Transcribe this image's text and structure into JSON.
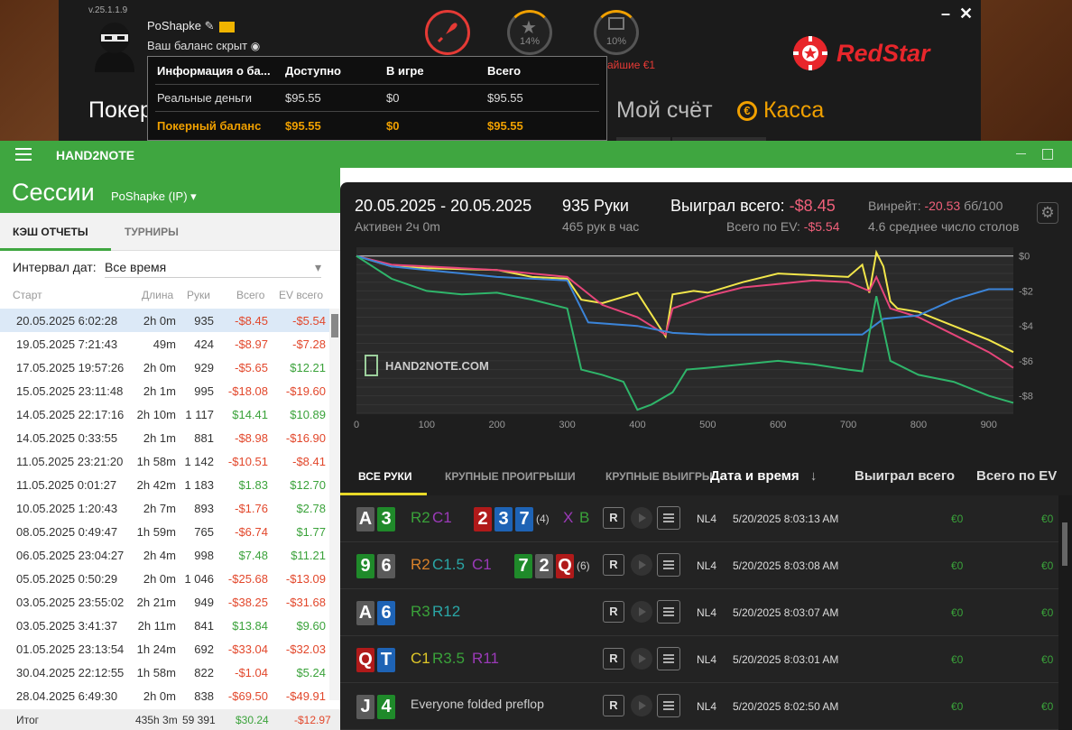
{
  "poker_client": {
    "version": "v.25.1.1.9",
    "username": "PoShapke",
    "balance_hidden": "Ваш баланс скрыт",
    "rakeback_pct": "14%",
    "gift_pct": "10%",
    "partial_text": "айшие €1",
    "brand": "RedStar",
    "tabs": [
      "Покер",
      "Мой счёт",
      "Касса"
    ]
  },
  "balance_popup": {
    "headers": [
      "Информация о ба...",
      "Доступно",
      "В игре",
      "Всего"
    ],
    "rows": [
      {
        "label": "Реальные деньги",
        "available": "$95.55",
        "in_game": "$0",
        "total": "$95.55"
      },
      {
        "label": "Покерный баланс",
        "available": "$95.55",
        "in_game": "$0",
        "total": "$95.55"
      }
    ]
  },
  "app": {
    "title": "HAND2NOTE",
    "page_title": "Сессии",
    "player": "PoShapke (IP)",
    "tabs": [
      "КЭШ ОТЧЕТЫ",
      "ТУРНИРЫ"
    ],
    "interval_label": "Интервал дат:",
    "interval_value": "Все время",
    "columns": [
      "Старт",
      "Длина",
      "Руки",
      "Всего",
      "EV всего"
    ],
    "sessions": [
      {
        "start": "20.05.2025 6:02:28",
        "len": "2h 0m",
        "hands": "935",
        "total": "-$8.45",
        "ev": "-$5.54"
      },
      {
        "start": "19.05.2025 7:21:43",
        "len": "49m",
        "hands": "424",
        "total": "-$8.97",
        "ev": "-$7.28"
      },
      {
        "start": "17.05.2025 19:57:26",
        "len": "2h 0m",
        "hands": "929",
        "total": "-$5.65",
        "ev": "$12.21"
      },
      {
        "start": "15.05.2025 23:11:48",
        "len": "2h 1m",
        "hands": "995",
        "total": "-$18.08",
        "ev": "-$19.60"
      },
      {
        "start": "14.05.2025 22:17:16",
        "len": "2h 10m",
        "hands": "1 117",
        "total": "$14.41",
        "ev": "$10.89"
      },
      {
        "start": "14.05.2025 0:33:55",
        "len": "2h 1m",
        "hands": "881",
        "total": "-$8.98",
        "ev": "-$16.90"
      },
      {
        "start": "11.05.2025 23:21:20",
        "len": "1h 58m",
        "hands": "1 142",
        "total": "-$10.51",
        "ev": "-$8.41"
      },
      {
        "start": "11.05.2025 0:01:27",
        "len": "2h 42m",
        "hands": "1 183",
        "total": "$1.83",
        "ev": "$12.70"
      },
      {
        "start": "10.05.2025 1:20:43",
        "len": "2h 7m",
        "hands": "893",
        "total": "-$1.76",
        "ev": "$2.78"
      },
      {
        "start": "08.05.2025 0:49:47",
        "len": "1h 59m",
        "hands": "765",
        "total": "-$6.74",
        "ev": "$1.77"
      },
      {
        "start": "06.05.2025 23:04:27",
        "len": "2h 4m",
        "hands": "998",
        "total": "$7.48",
        "ev": "$11.21"
      },
      {
        "start": "05.05.2025 0:50:29",
        "len": "2h 0m",
        "hands": "1 046",
        "total": "-$25.68",
        "ev": "-$13.09"
      },
      {
        "start": "03.05.2025 23:55:02",
        "len": "2h 21m",
        "hands": "949",
        "total": "-$38.25",
        "ev": "-$31.68"
      },
      {
        "start": "03.05.2025 3:41:37",
        "len": "2h 11m",
        "hands": "841",
        "total": "$13.84",
        "ev": "$9.60"
      },
      {
        "start": "01.05.2025 23:13:54",
        "len": "1h 24m",
        "hands": "692",
        "total": "-$33.04",
        "ev": "-$32.03"
      },
      {
        "start": "30.04.2025 22:12:55",
        "len": "1h 58m",
        "hands": "822",
        "total": "-$1.04",
        "ev": "$5.24"
      },
      {
        "start": "28.04.2025 6:49:30",
        "len": "2h 0m",
        "hands": "838",
        "total": "-$69.50",
        "ev": "-$49.91"
      }
    ],
    "totals": {
      "label": "Итог",
      "len": "435h 3m",
      "hands": "59 391",
      "total": "$30.24",
      "ev": "-$12.97"
    }
  },
  "summary": {
    "date_range": "20.05.2025 - 20.05.2025",
    "active": "Активен 2ч 0m",
    "hands": "935 Руки",
    "hands_per_hour": "465 рук в час",
    "won_label": "Выиграл всего:",
    "won_value": "-$8.45",
    "ev_label": "Всего по EV:",
    "ev_value": "-$5.54",
    "winrate_label": "Винрейт:",
    "winrate_value": "-20.53",
    "winrate_unit": "бб/100",
    "tables": "4.6 среднее число столов",
    "watermark": "HAND2NOTE.COM"
  },
  "chart_data": {
    "type": "line",
    "x_ticks": [
      0,
      100,
      200,
      300,
      400,
      500,
      600,
      700,
      800,
      900
    ],
    "y_ticks": [
      "$0",
      "-$2",
      "-$4",
      "-$6",
      "-$8"
    ],
    "xlim": [
      0,
      935
    ],
    "ylim": [
      -9,
      0.5
    ],
    "series": [
      {
        "color": "#f2e64a",
        "x": [
          0,
          50,
          100,
          200,
          250,
          300,
          320,
          350,
          400,
          440,
          450,
          480,
          500,
          550,
          600,
          650,
          700,
          720,
          730,
          740,
          750,
          760,
          770,
          800,
          850,
          900,
          935
        ],
        "y": [
          0,
          -0.6,
          -0.7,
          -0.8,
          -1.2,
          -1.3,
          -2.5,
          -2.7,
          -2.1,
          -4.6,
          -2.2,
          -2.0,
          -2.1,
          -1.5,
          -1.0,
          -1.1,
          -1.2,
          -0.5,
          -2.1,
          0.2,
          -0.6,
          -2.6,
          -3.0,
          -3.2,
          -4.0,
          -4.8,
          -5.5
        ]
      },
      {
        "color": "#e6457a",
        "x": [
          0,
          50,
          100,
          150,
          200,
          250,
          300,
          350,
          400,
          440,
          450,
          500,
          550,
          600,
          650,
          700,
          730,
          740,
          760,
          800,
          850,
          900,
          935
        ],
        "y": [
          0,
          -0.5,
          -0.6,
          -0.7,
          -0.8,
          -1.0,
          -1.2,
          -2.8,
          -3.5,
          -4.5,
          -3.0,
          -2.3,
          -1.8,
          -1.6,
          -1.4,
          -1.5,
          -2.0,
          -1.2,
          -3.0,
          -3.5,
          -4.5,
          -5.5,
          -6.4
        ]
      },
      {
        "color": "#3b84d8",
        "x": [
          0,
          50,
          100,
          200,
          300,
          330,
          400,
          450,
          500,
          700,
          720,
          750,
          800,
          850,
          900,
          935
        ],
        "y": [
          0,
          -0.6,
          -0.8,
          -1.2,
          -1.4,
          -3.8,
          -4.0,
          -4.4,
          -4.5,
          -4.5,
          -4.5,
          -3.6,
          -3.4,
          -2.5,
          -1.9,
          -1.9
        ]
      },
      {
        "color": "#2fb56a",
        "x": [
          0,
          50,
          100,
          150,
          200,
          250,
          300,
          320,
          350,
          380,
          400,
          420,
          450,
          470,
          500,
          550,
          600,
          650,
          700,
          720,
          740,
          760,
          800,
          850,
          900,
          935
        ],
        "y": [
          0,
          -1.3,
          -2.0,
          -2.2,
          -2.1,
          -2.5,
          -3.0,
          -6.5,
          -6.8,
          -7.2,
          -8.8,
          -8.5,
          -7.8,
          -6.5,
          -6.4,
          -6.2,
          -6.0,
          -6.2,
          -6.5,
          -6.6,
          -2.3,
          -6.0,
          -6.8,
          -7.2,
          -8.0,
          -8.4
        ]
      }
    ]
  },
  "hand_tabs": [
    "ВСЕ РУКИ",
    "КРУПНЫЕ ПРОИГРЫШИ",
    "КРУПНЫЕ ВЫИГРЫ"
  ],
  "hand_columns": [
    "Дата и время",
    "Выиграл всего",
    "Всего по EV"
  ],
  "hands": [
    {
      "cards": [
        {
          "r": "A",
          "c": "#5a5a5a"
        },
        {
          "r": "3",
          "c": "#1f8a2a"
        }
      ],
      "actions": [
        {
          "t": "R2",
          "c": "#3aa23a"
        },
        {
          "t": "C1",
          "c": "#9b3ab8"
        }
      ],
      "board": [
        {
          "r": "2",
          "c": "#b01a1a"
        },
        {
          "r": "3",
          "c": "#1e63b5"
        },
        {
          "r": "7",
          "c": "#1e63b5"
        }
      ],
      "pot": "(4)",
      "post": [
        {
          "t": "X",
          "c": "#9b3ab8"
        },
        {
          "t": "B",
          "c": "#3aa23a"
        }
      ],
      "btn": "R",
      "limit": "NL4",
      "date": "5/20/2025 8:03:13 AM",
      "won": "€0",
      "ev": "€0"
    },
    {
      "cards": [
        {
          "r": "9",
          "c": "#1f8a2a"
        },
        {
          "r": "6",
          "c": "#5a5a5a"
        }
      ],
      "actions": [
        {
          "t": "R2",
          "c": "#d9822b"
        },
        {
          "t": "C1.5",
          "c": "#2aa6a6"
        },
        {
          "t": "C1",
          "c": "#9b3ab8"
        }
      ],
      "board": [
        {
          "r": "7",
          "c": "#1f8a2a"
        },
        {
          "r": "2",
          "c": "#5a5a5a"
        },
        {
          "r": "Q",
          "c": "#b01a1a"
        }
      ],
      "pot": "(6)",
      "post": [],
      "btn": "R",
      "limit": "NL4",
      "date": "5/20/2025 8:03:08 AM",
      "won": "€0",
      "ev": "€0"
    },
    {
      "cards": [
        {
          "r": "A",
          "c": "#5a5a5a"
        },
        {
          "r": "6",
          "c": "#1e63b5"
        }
      ],
      "actions": [
        {
          "t": "R3",
          "c": "#3aa23a"
        },
        {
          "t": "R12",
          "c": "#2aa6a6"
        }
      ],
      "board": [],
      "pot": "",
      "post": [],
      "btn": "R",
      "limit": "NL4",
      "date": "5/20/2025 8:03:07 AM",
      "won": "€0",
      "ev": "€0"
    },
    {
      "cards": [
        {
          "r": "Q",
          "c": "#b01a1a"
        },
        {
          "r": "T",
          "c": "#1e63b5"
        }
      ],
      "actions": [
        {
          "t": "C1",
          "c": "#e0c829"
        },
        {
          "t": "R3.5",
          "c": "#3aa23a"
        },
        {
          "t": "R11",
          "c": "#9b3ab8"
        }
      ],
      "board": [],
      "pot": "",
      "post": [],
      "btn": "R",
      "limit": "NL4",
      "date": "5/20/2025 8:03:01 AM",
      "won": "€0",
      "ev": "€0"
    },
    {
      "cards": [
        {
          "r": "J",
          "c": "#5a5a5a"
        },
        {
          "r": "4",
          "c": "#1f8a2a"
        }
      ],
      "actions": [
        {
          "t": "Everyone folded preflop",
          "c": "#cfcfcf"
        }
      ],
      "board": [],
      "pot": "",
      "post": [],
      "btn": "R",
      "limit": "NL4",
      "date": "5/20/2025 8:02:50 AM",
      "won": "€0",
      "ev": "€0"
    }
  ]
}
